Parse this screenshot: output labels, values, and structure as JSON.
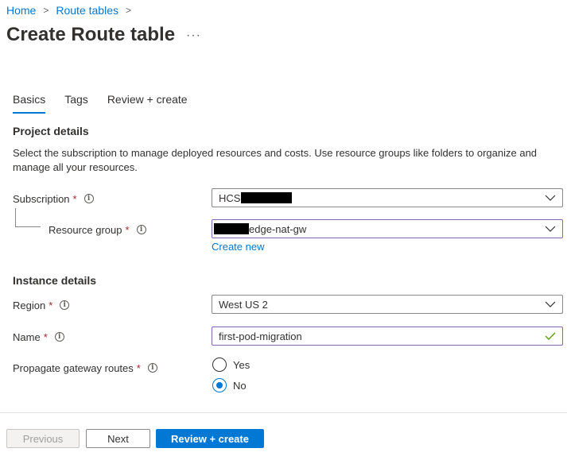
{
  "breadcrumb": {
    "items": [
      "Home",
      "Route tables"
    ],
    "separator": ">"
  },
  "page": {
    "title": "Create Route table",
    "more_label": "···"
  },
  "tabs": [
    {
      "label": "Basics",
      "active": true
    },
    {
      "label": "Tags",
      "active": false
    },
    {
      "label": "Review + create",
      "active": false
    }
  ],
  "project_details": {
    "heading": "Project details",
    "description": "Select the subscription to manage deployed resources and costs. Use resource groups like folders to organize and manage all your resources.",
    "subscription": {
      "label": "Subscription",
      "required_mark": "*",
      "value": "HCS",
      "redacted": true
    },
    "resource_group": {
      "label": "Resource group",
      "required_mark": "*",
      "value": "edge-nat-gw",
      "redacted_prefix": true
    },
    "create_new_link": "Create new"
  },
  "instance_details": {
    "heading": "Instance details",
    "region": {
      "label": "Region",
      "required_mark": "*",
      "value": "West US 2"
    },
    "name": {
      "label": "Name",
      "required_mark": "*",
      "value": "first-pod-migration",
      "valid": true
    },
    "propagate": {
      "label": "Propagate gateway routes",
      "required_mark": "*",
      "options": [
        "Yes",
        "No"
      ],
      "selected": "No"
    }
  },
  "footer": {
    "previous_label": "Previous",
    "next_label": "Next",
    "review_create_label": "Review + create"
  },
  "colors": {
    "accent": "#0078d4",
    "required": "#a4262c",
    "valid": "#57a300",
    "focus_border": "#8764b8"
  }
}
